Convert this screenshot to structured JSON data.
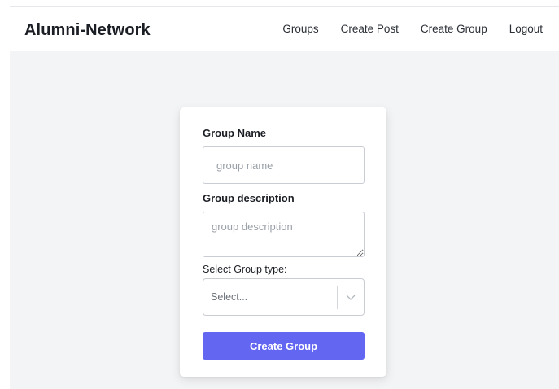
{
  "header": {
    "brand": "Alumni-Network",
    "nav": [
      {
        "label": "Groups"
      },
      {
        "label": "Create Post"
      },
      {
        "label": "Create Group"
      },
      {
        "label": "Logout"
      }
    ]
  },
  "form": {
    "group_name_label": "Group Name",
    "group_name_placeholder": "group name",
    "group_name_value": "",
    "description_label": "Group description",
    "description_placeholder": "group description",
    "description_value": "",
    "type_label": "Select Group type:",
    "type_selected": "Select...",
    "submit_label": "Create Group"
  },
  "colors": {
    "accent": "#6366f1",
    "content_background": "#f3f4f6"
  },
  "icons": {
    "select_indicator": "chevron-down-icon"
  }
}
